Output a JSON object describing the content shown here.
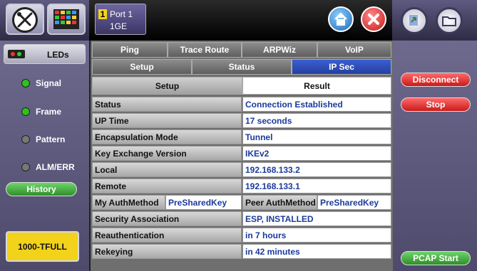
{
  "header": {
    "port_number": "1",
    "port_title": "Port 1",
    "port_sub": "1GE"
  },
  "sidebar": {
    "leds_label": "LEDs",
    "items": [
      {
        "label": "Signal",
        "status": "green"
      },
      {
        "label": "Frame",
        "status": "green"
      },
      {
        "label": "Pattern",
        "status": "off"
      },
      {
        "label": "ALM/ERR",
        "status": "off"
      }
    ],
    "history_label": "History",
    "mode_label": "1000-TFULL"
  },
  "tabs": {
    "top": [
      "Ping",
      "Trace Route",
      "ARPWiz",
      "VoIP"
    ],
    "second": [
      "Setup",
      "Status",
      "IP Sec"
    ],
    "third": [
      "Setup",
      "Result"
    ]
  },
  "table": {
    "rows": [
      {
        "label": "Status",
        "value": "Connection Established"
      },
      {
        "label": "UP Time",
        "value": "17 seconds"
      },
      {
        "label": "Encapsulation Mode",
        "value": "Tunnel"
      },
      {
        "label": "Key Exchange Version",
        "value": "IKEv2"
      },
      {
        "label": "Local",
        "value": "192.168.133.2"
      },
      {
        "label": "Remote",
        "value": "192.168.133.1"
      }
    ],
    "auth": {
      "my_label": "My AuthMethod",
      "my_value": "PreSharedKey",
      "peer_label": "Peer AuthMethod",
      "peer_value": "PreSharedKey"
    },
    "rows2": [
      {
        "label": "Security Association",
        "value": "ESP, INSTALLED"
      },
      {
        "label": "Reauthentication",
        "value": "in 7 hours"
      },
      {
        "label": "Rekeying",
        "value": "in 42 minutes"
      }
    ]
  },
  "right": {
    "disconnect_label": "Disconnect",
    "stop_label": "Stop",
    "pcap_label": "PCAP Start"
  },
  "colors": {
    "led_green": "#2ec21c",
    "led_off": "#777777",
    "disconnect": "#d42a2a",
    "pcap": "#3aa832",
    "mode_yellow": "#f2d21a"
  }
}
